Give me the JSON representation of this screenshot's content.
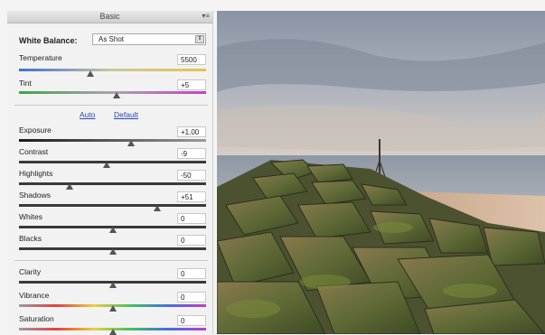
{
  "panel": {
    "title": "Basic",
    "menu_icon": "panel-menu-icon",
    "white_balance": {
      "label": "White Balance:",
      "value": "As Shot"
    },
    "temperature": {
      "label": "Temperature",
      "value": "5500",
      "position": 0.38
    },
    "tint": {
      "label": "Tint",
      "value": "+5",
      "position": 0.52
    },
    "auto_label": "Auto",
    "default_label": "Default",
    "tone": [
      {
        "label": "Exposure",
        "value": "+1.00",
        "position": 0.6
      },
      {
        "label": "Contrast",
        "value": "-9",
        "position": 0.47
      },
      {
        "label": "Highlights",
        "value": "-50",
        "position": 0.27
      },
      {
        "label": "Shadows",
        "value": "+51",
        "position": 0.74
      },
      {
        "label": "Whites",
        "value": "0",
        "position": 0.5
      },
      {
        "label": "Blacks",
        "value": "0",
        "position": 0.5
      }
    ],
    "presence": [
      {
        "label": "Clarity",
        "value": "0",
        "position": 0.5
      },
      {
        "label": "Vibrance",
        "value": "0",
        "position": 0.5
      },
      {
        "label": "Saturation",
        "value": "0",
        "position": 0.5
      }
    ]
  },
  "colors": {
    "link": "#2a48b8",
    "panel_bg": "#f2f2f2"
  }
}
